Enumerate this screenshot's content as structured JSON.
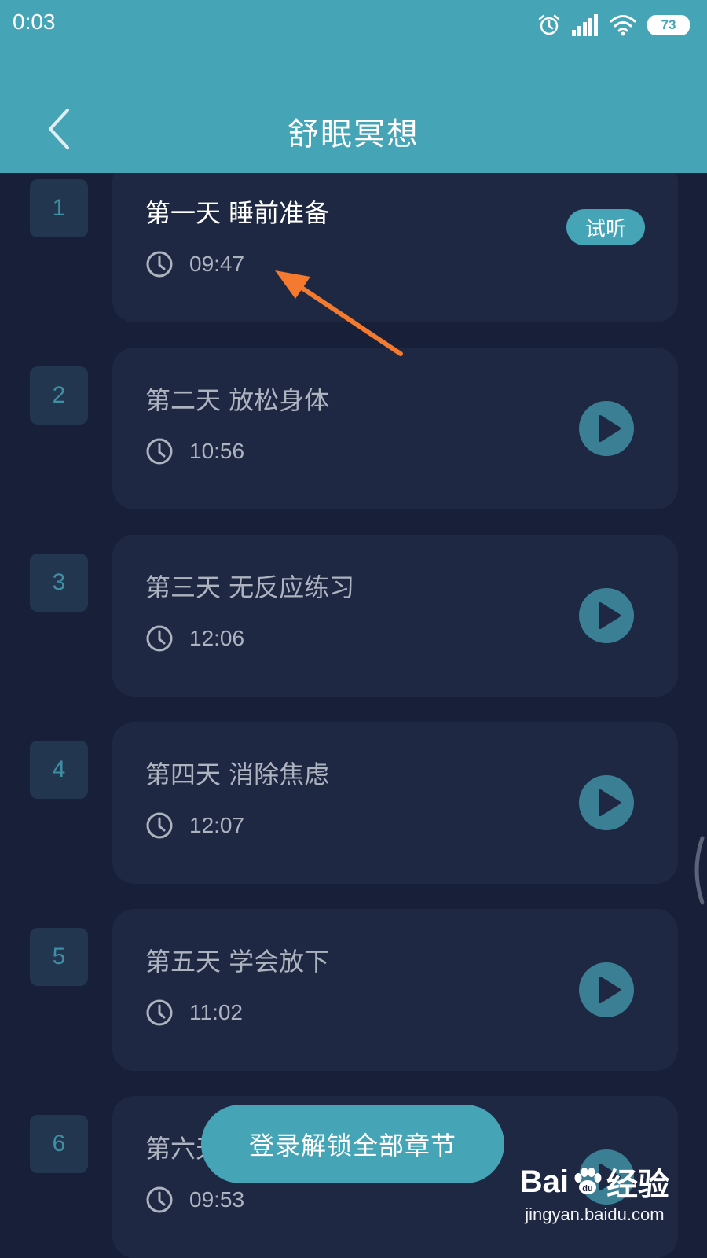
{
  "status_bar": {
    "time": "0:03",
    "battery": "73"
  },
  "header": {
    "title": "舒眠冥想"
  },
  "lessons": [
    {
      "number": "1",
      "title": "第一天 睡前准备",
      "duration": "09:47",
      "badge": "试听"
    },
    {
      "number": "2",
      "title": "第二天 放松身体",
      "duration": "10:56"
    },
    {
      "number": "3",
      "title": "第三天 无反应练习",
      "duration": "12:06"
    },
    {
      "number": "4",
      "title": "第四天 消除焦虑",
      "duration": "12:07"
    },
    {
      "number": "5",
      "title": "第五天 学会放下",
      "duration": "11:02"
    },
    {
      "number": "6",
      "title": "第六天",
      "duration": "09:53"
    }
  ],
  "login_button": {
    "label": "登录解锁全部章节"
  },
  "watermark": {
    "brand_left": "Bai",
    "brand_du": "du",
    "brand_right": "经验",
    "url": "jingyan.baidu.com"
  },
  "colors": {
    "accent": "#45a4b6",
    "background": "#182039",
    "card": "#1f2842",
    "annotation_arrow": "#f47a2f"
  }
}
